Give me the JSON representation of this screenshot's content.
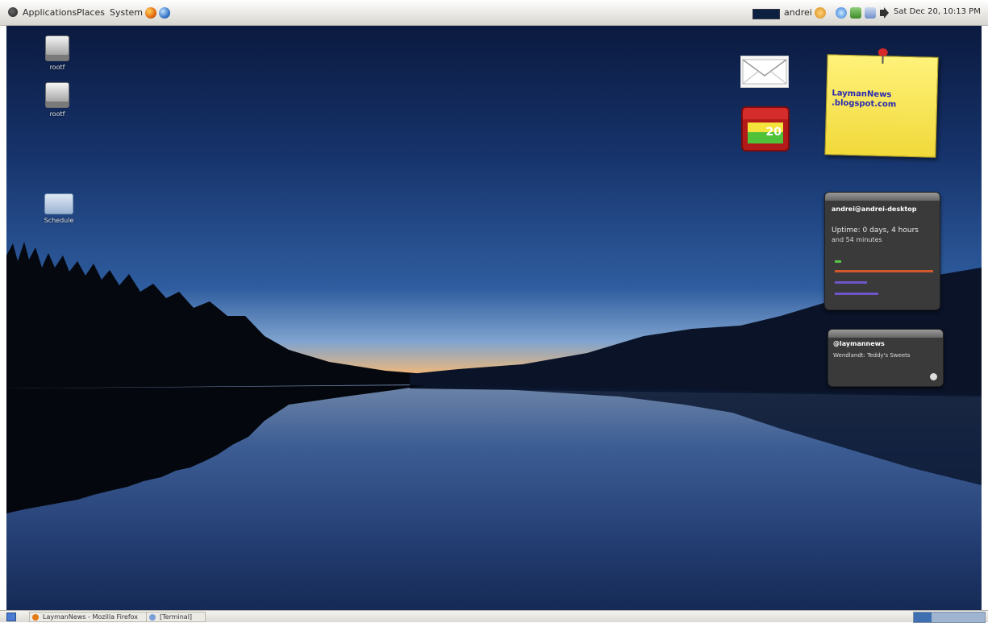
{
  "top_panel": {
    "menus": [
      "Applications",
      "Places",
      "System"
    ],
    "user_name": "andrei",
    "clock": "Sat Dec 20, 10:13 PM"
  },
  "desktop": {
    "icons": [
      {
        "label": "rootf",
        "icon": "drive-icon"
      },
      {
        "label": "rootf",
        "icon": "drive-icon"
      },
      {
        "label": "Schedule",
        "icon": "folder-icon"
      }
    ]
  },
  "widgets": {
    "calendar": {
      "day": "20"
    },
    "sticky_note": {
      "line1": "LaymanNews",
      "line2": ".blogspot.com"
    },
    "sysinfo": {
      "title": "andrei@andrei-desktop",
      "uptime": "Uptime: 0 days, 4 hours",
      "uptime_minutes": "and 54 minutes"
    },
    "rss": {
      "title": "@laymannews",
      "item": "Wendlandt: Teddy's Sweets"
    }
  },
  "bottom_panel": {
    "tasks": [
      {
        "label": "LaymanNews - Mozilla Firefox",
        "icon": "firefox-icon"
      },
      {
        "label": "[Terminal]",
        "icon": "terminal-icon"
      }
    ]
  },
  "colors": {
    "sticky_note": "#f1d93a",
    "sticky_text": "#2a2ab0",
    "sysinfo_bar_orange": "#d0582c",
    "sysinfo_bar_purple": "#6f55c9"
  }
}
